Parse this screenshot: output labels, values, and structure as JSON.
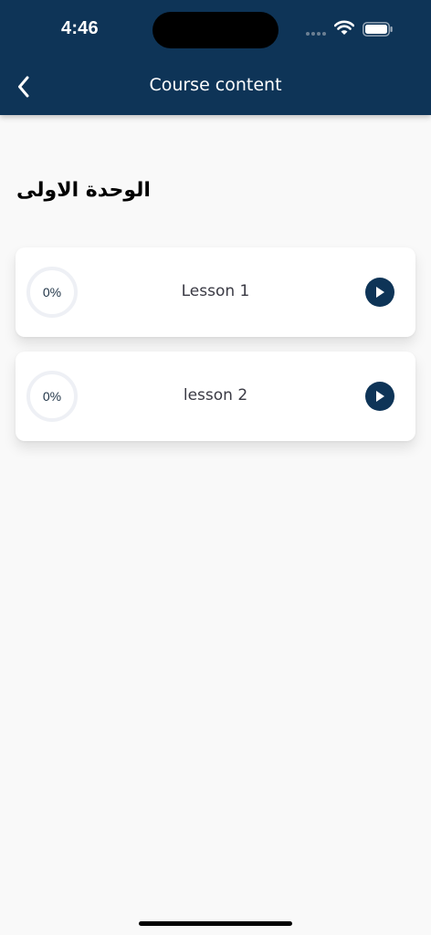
{
  "status_bar": {
    "time": "4:46"
  },
  "header": {
    "title": "Course content"
  },
  "unit": {
    "title": "الوحدة الاولى"
  },
  "lessons": [
    {
      "title": "Lesson 1",
      "progress_text": "0%",
      "progress": 0
    },
    {
      "title": "lesson 2",
      "progress_text": "0%",
      "progress": 0
    }
  ],
  "icons": {
    "back": "chevron-left-icon",
    "play": "play-icon",
    "wifi": "wifi-icon",
    "battery": "battery-icon"
  },
  "colors": {
    "header_bg": "#0e3457",
    "page_bg": "#f9f9f9",
    "card_bg": "#ffffff",
    "accent": "#0e3457",
    "ring_track": "#eef0f5"
  }
}
